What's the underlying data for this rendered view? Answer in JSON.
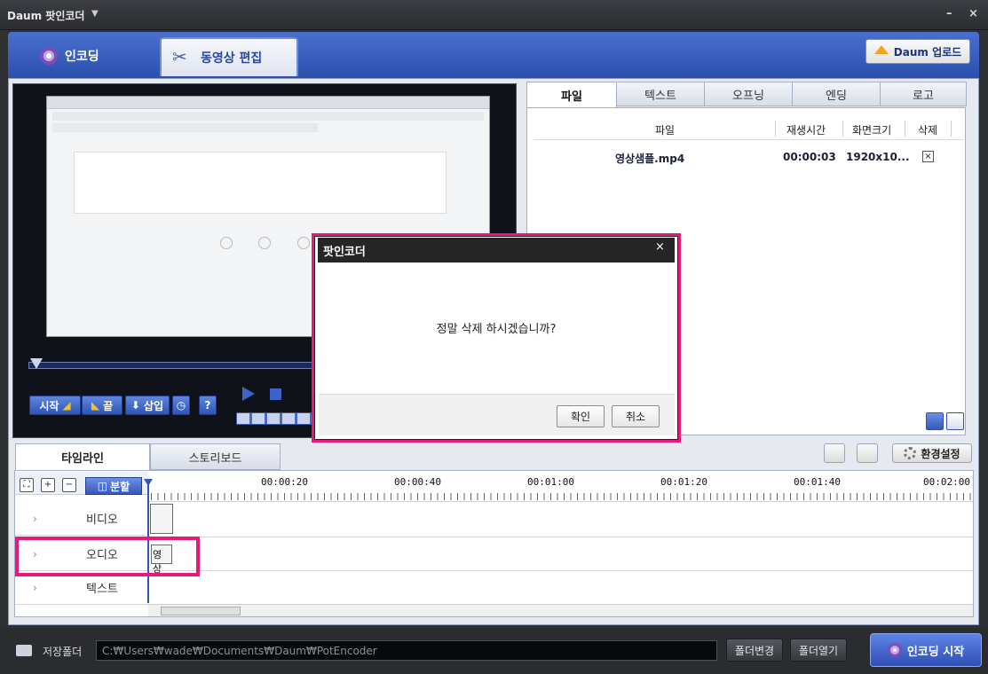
{
  "window": {
    "title": "Daum 팟인코더",
    "minimize": "–",
    "close": "×"
  },
  "top_tabs": {
    "encoding": "인코딩",
    "video_edit": "동영상 편집"
  },
  "upload_button": "Daum 업로드",
  "player": {
    "start_label": "시작",
    "end_label": "끝",
    "insert_label": "삽입",
    "help_label": "?"
  },
  "file_panel": {
    "tabs": [
      "파일",
      "텍스트",
      "오프닝",
      "엔딩",
      "로고"
    ],
    "active_tab": "파일",
    "columns": [
      "파일",
      "재생시간",
      "화면크기",
      "삭제"
    ],
    "rows": [
      {
        "file": "영상샘플.mp4",
        "duration": "00:00:03",
        "size": "1920x10...",
        "delete": "×"
      }
    ]
  },
  "timeline": {
    "tabs": [
      "타임라인",
      "스토리보드"
    ],
    "settings_label": "환경설정",
    "split_label": "분할",
    "ruler": [
      "00:00:20",
      "00:00:40",
      "00:01:00",
      "00:01:20",
      "00:01:40",
      "00:02:00"
    ],
    "tracks": [
      "비디오",
      "오디오",
      "텍스트"
    ],
    "audio_clip_label": "영상"
  },
  "bottom": {
    "folder_label": "저장폴더",
    "folder_path": "C:₩Users₩wade₩Documents₩Daum₩PotEncoder",
    "change_folder": "폴더변경",
    "open_folder": "폴더열기",
    "start_encoding": "인코딩 시작"
  },
  "dialog": {
    "title": "팟인코더",
    "close": "×",
    "message": "정말 삭제 하시겠습니까?",
    "confirm": "확인",
    "cancel": "취소"
  },
  "colors": {
    "accent_blue": "#2f55b8",
    "highlight": "#e8197a"
  }
}
